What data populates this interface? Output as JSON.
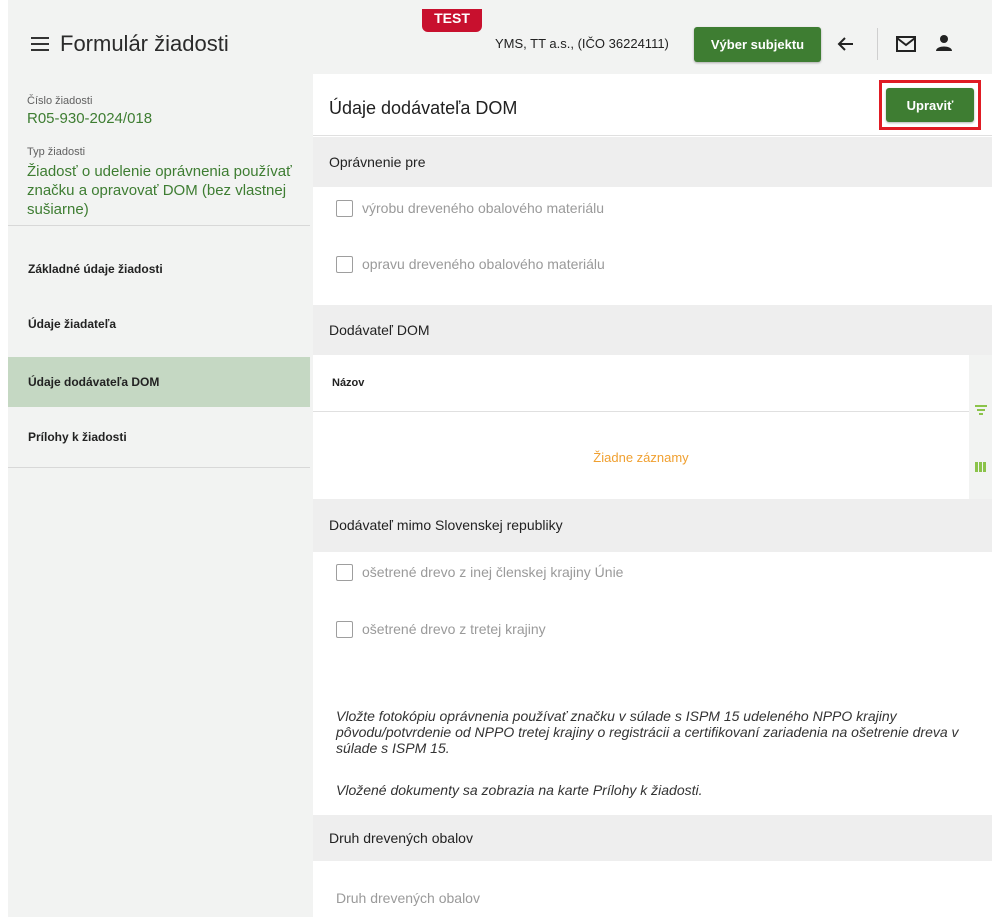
{
  "header": {
    "title": "Formulár žiadosti",
    "env_badge": "TEST",
    "subject": "YMS, TT a.s., (IČO 36224111)",
    "select_subject_label": "Výber subjektu"
  },
  "sidebar": {
    "request_number_label": "Číslo žiadosti",
    "request_number": "R05-930-2024/018",
    "request_type_label": "Typ žiadosti",
    "request_type": "Žiadosť o udelenie oprávnenia používať značku a opravovať DOM (bez vlastnej sušiarne)",
    "items": [
      {
        "label": "Základné údaje žiadosti",
        "active": false
      },
      {
        "label": "Údaje žiadateľa",
        "active": false
      },
      {
        "label": "Údaje dodávateľa DOM",
        "active": true
      },
      {
        "label": "Prílohy k žiadosti",
        "active": false
      }
    ]
  },
  "main": {
    "title": "Údaje dodávateľa DOM",
    "edit_label": "Upraviť",
    "authorization": {
      "heading": "Oprávnenie pre",
      "options": [
        {
          "label": "výrobu dreveného obalového materiálu",
          "checked": false
        },
        {
          "label": "opravu dreveného obalového materiálu",
          "checked": false
        }
      ]
    },
    "supplier": {
      "heading": "Dodávateľ DOM",
      "column_name": "Názov",
      "empty_message": "Žiadne záznamy"
    },
    "foreign_supplier": {
      "heading": "Dodávateľ mimo Slovenskej republiky",
      "options": [
        {
          "label": "ošetrené drevo z inej členskej krajiny Únie",
          "checked": false
        },
        {
          "label": "ošetrené drevo z tretej krajiny",
          "checked": false
        }
      ],
      "note1": "Vložte fotokópiu oprávnenia používať značku v súlade s ISPM 15 udeleného NPPO krajiny pôvodu/potvrdenie od NPPO tretej krajiny o registrácii a certifikovaní zariadenia na ošetrenie dreva v súlade s ISPM 15.",
      "note2": "Vložené dokumenty sa zobrazia na karte Prílohy k žiadosti."
    },
    "packaging": {
      "heading": "Druh drevených obalov",
      "placeholder": "Druh drevených obalov"
    }
  },
  "colors": {
    "brand_green": "#3e7d32",
    "active_nav": "#c5d8c3",
    "badge_red": "#c8102e",
    "highlight_red": "#e01b24",
    "empty_orange": "#f0a030"
  }
}
